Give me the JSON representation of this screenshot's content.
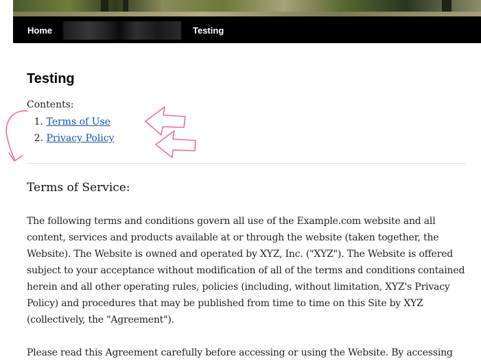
{
  "nav": {
    "home_label": "Home",
    "testing_label": "Testing"
  },
  "page": {
    "title": "Testing",
    "contents_label": "Contents:",
    "toc": [
      {
        "num": "1.",
        "label": "Terms of Use"
      },
      {
        "num": "2.",
        "label": "Privacy Policy"
      }
    ]
  },
  "section": {
    "heading": "Terms of Service:",
    "paragraphs": [
      "The following terms and conditions govern all use of the Example.com website and all content, services and products available at or through the website (taken together, the Website). The Website is owned and operated by XYZ, Inc. (\"XYZ\"). The Website is offered subject to your acceptance without modification of all of the terms and conditions contained herein and all other operating rules, policies (including, without limitation, XYZ's Privacy Policy) and procedures that may be published from time to time on this Site by XYZ (collectively, the \"Agreement\").",
      "Please read this Agreement carefully before accessing or using the Website. By accessing"
    ]
  },
  "colors": {
    "link": "#1a52b5",
    "navbar": "#000000",
    "annotation": "#f06aa4"
  },
  "icons": [
    "left-arrow-annotation-icon",
    "curved-arrow-annotation-icon"
  ]
}
